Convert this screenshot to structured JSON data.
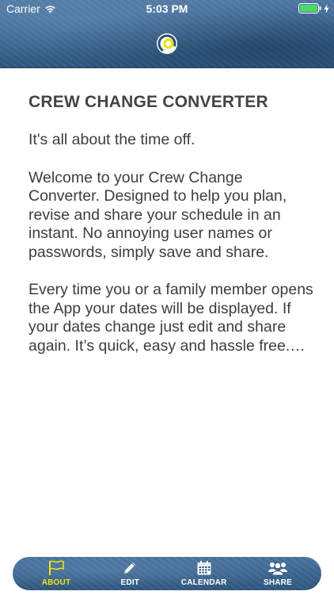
{
  "status_bar": {
    "carrier": "Carrier",
    "time": "5:03 PM",
    "wifi_icon": "wifi-icon",
    "battery_icon": "battery-icon"
  },
  "header": {
    "logo_icon": "app-logo-icon",
    "accent_color": "#e8e000"
  },
  "content": {
    "title": "CREW CHANGE CONVERTER",
    "paragraphs": [
      "It's all about the time off.",
      "Welcome to your Crew Change Converter. Designed to help you plan, revise and share your schedule in an instant. No annoying user names or passwords, simply save and share.",
      "Every time you or a family member opens the App your dates will be displayed. If your dates change just edit and share again. It’s quick, easy and hassle free.…"
    ]
  },
  "tabbar": {
    "active_color": "#f2e313",
    "tabs": [
      {
        "label": "ABOUT",
        "icon": "flag-icon",
        "active": true
      },
      {
        "label": "EDIT",
        "icon": "pencil-icon",
        "active": false
      },
      {
        "label": "CALENDAR",
        "icon": "calendar-icon",
        "active": false
      },
      {
        "label": "SHARE",
        "icon": "people-icon",
        "active": false
      }
    ]
  }
}
